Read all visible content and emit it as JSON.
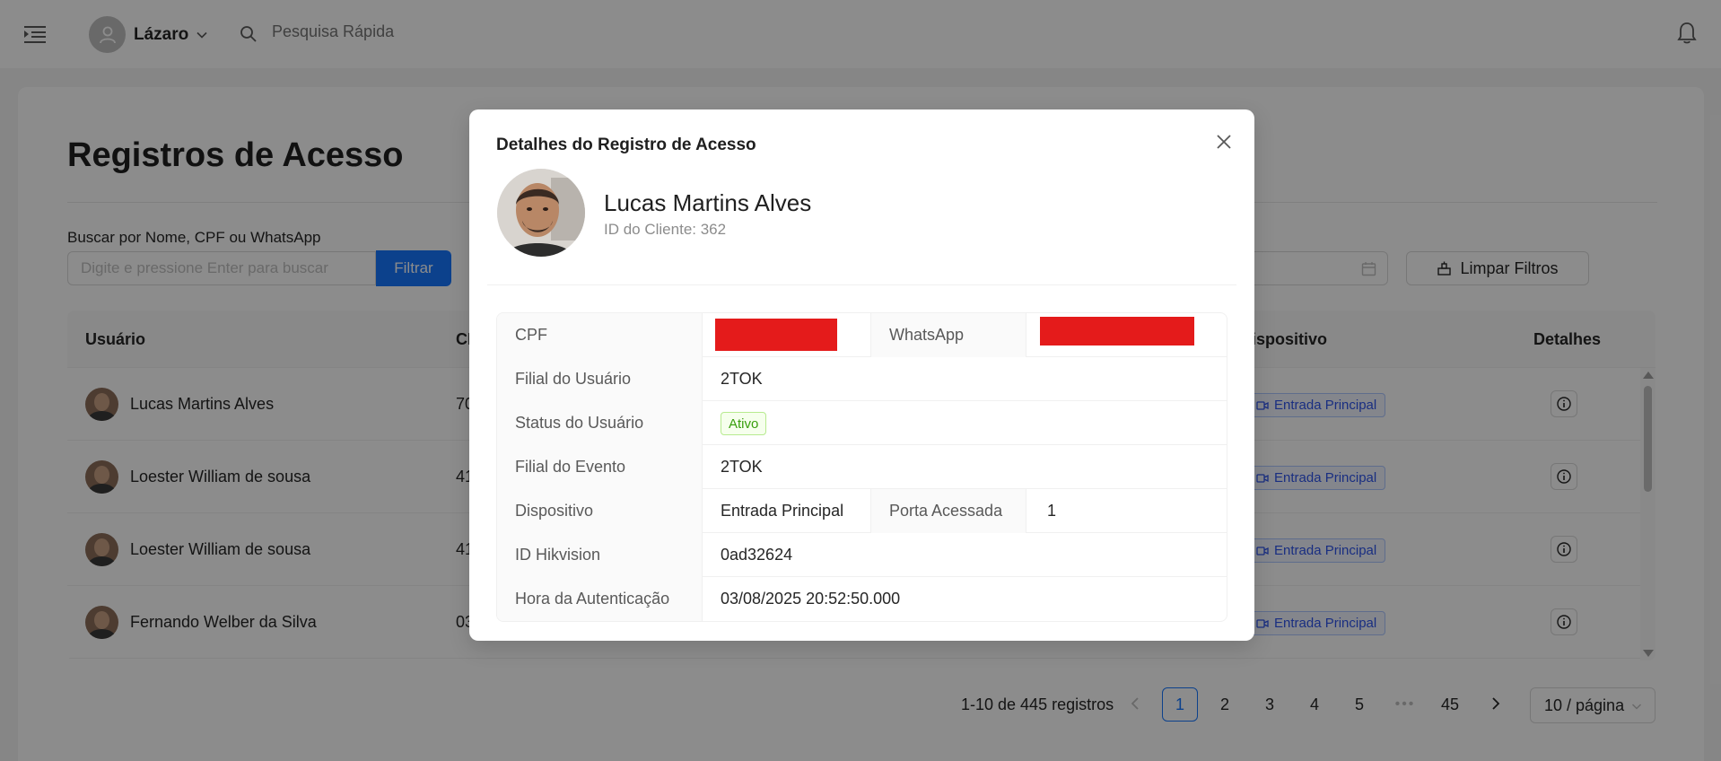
{
  "header": {
    "user_name": "Lázaro",
    "quick_search_placeholder": "Pesquisa Rápida"
  },
  "page": {
    "title": "Registros de Acesso",
    "search_label": "Buscar por Nome, CPF ou WhatsApp",
    "search_placeholder": "Digite e pressione Enter para buscar",
    "filter_label": "Filtrar",
    "clear_filters_label": "Limpar Filtros"
  },
  "table": {
    "columns": {
      "user": "Usuário",
      "cpf": "CI",
      "device": "ispositivo",
      "details": "Detalhes"
    },
    "rows": [
      {
        "name": "Lucas Martins Alves",
        "cpf": "70",
        "device": "Entrada Principal"
      },
      {
        "name": "Loester William de sousa",
        "cpf": "41",
        "device": "Entrada Principal"
      },
      {
        "name": "Loester William de sousa",
        "cpf": "41",
        "device": "Entrada Principal"
      },
      {
        "name": "Fernando Welber da Silva",
        "cpf": "03",
        "device": "Entrada Principal"
      }
    ]
  },
  "pagination": {
    "total_text": "1-10 de 445 registros",
    "pages": [
      "1",
      "2",
      "3",
      "4",
      "5"
    ],
    "last_page": "45",
    "current_page": "1",
    "page_size": "10 / página"
  },
  "modal": {
    "title": "Detalhes do Registro de Acesso",
    "name": "Lucas Martins Alves",
    "client_id": "ID do Cliente: 362",
    "fields": {
      "cpf_label": "CPF",
      "whatsapp_label": "WhatsApp",
      "user_branch_label": "Filial do Usuário",
      "user_branch": "2TOK",
      "user_status_label": "Status do Usuário",
      "user_status": "Ativo",
      "event_branch_label": "Filial do Evento",
      "event_branch": "2TOK",
      "device_label": "Dispositivo",
      "device": "Entrada Principal",
      "door_label": "Porta Acessada",
      "door": "1",
      "hikvision_label": "ID Hikvision",
      "hikvision": "0ad32624",
      "auth_time_label": "Hora da Autenticação",
      "auth_time": "03/08/2025 20:52:50.000"
    }
  },
  "colors": {
    "primary": "#1677ff",
    "redaction": "#e41b1b",
    "status_active": "#389e0d",
    "device_tag": "#2f54eb"
  }
}
